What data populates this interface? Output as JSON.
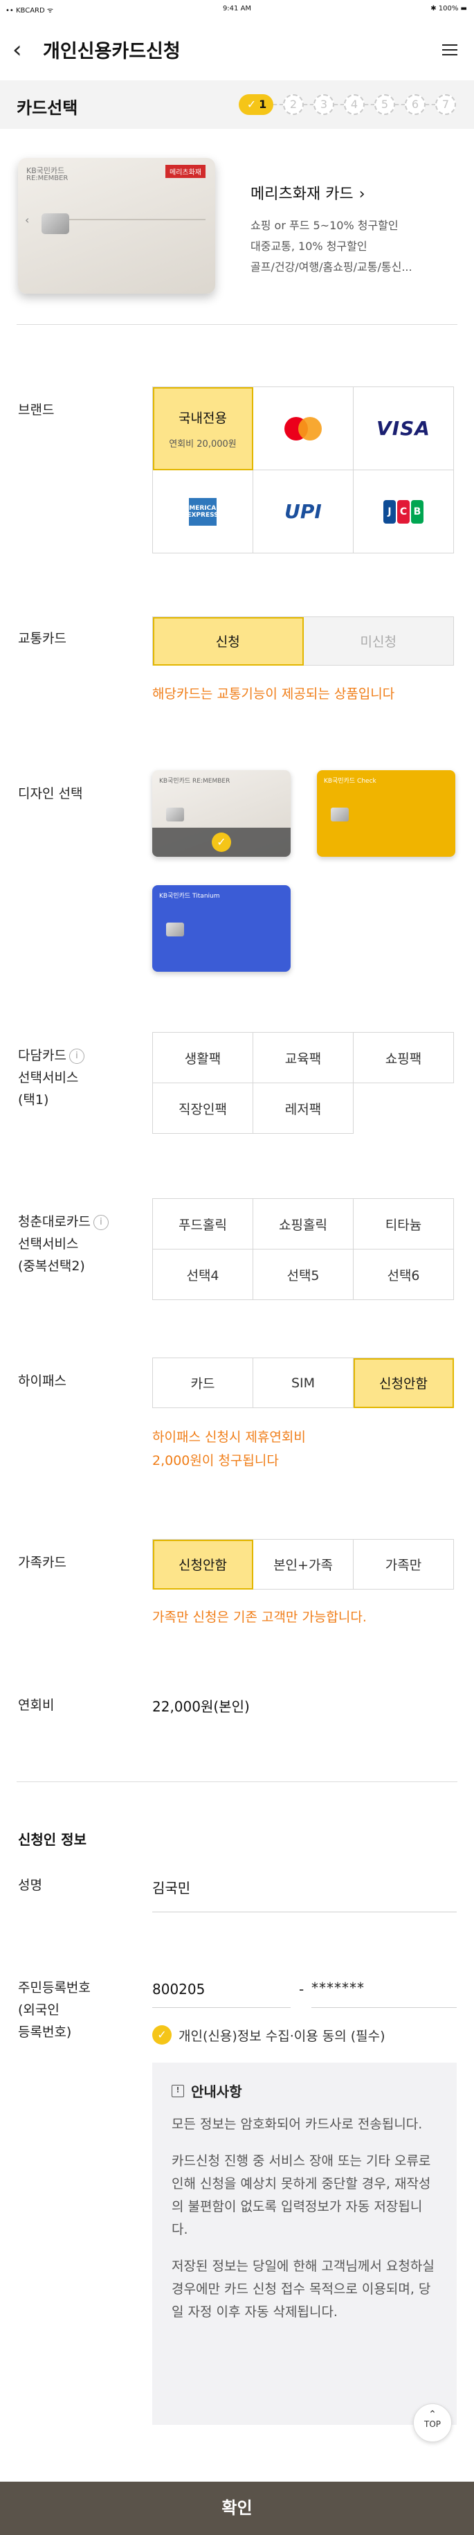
{
  "statusbar": {
    "carrier": "•• KBCARD ᯤ",
    "time": "9:41 AM",
    "battery": "✱ 100% ▬"
  },
  "header": {
    "title": "개인신용카드신청"
  },
  "step_bar": {
    "title": "카드선택",
    "steps": [
      "1",
      "2",
      "3",
      "4",
      "5",
      "6",
      "7"
    ],
    "current_step": 1
  },
  "card": {
    "image_bank": "KB국민카드",
    "image_sub": "RE:MEMBER",
    "image_partner": "메리츠화재",
    "name": "메리츠화재 카드",
    "benefits": [
      "쇼핑 or 푸드 5~10% 청구할인",
      "대중교통, 10% 청구할인",
      "골프/건강/여행/홈쇼핑/교통/통신..."
    ]
  },
  "brand": {
    "label": "브랜드",
    "domestic_label": "국내전용",
    "domestic_fee": "연회비 20,000원",
    "options": [
      "mastercard-logo",
      "visa-logo",
      "amex-logo",
      "upi-logo",
      "jcb-logo"
    ],
    "visa_text": "VISA",
    "upi_text": "UPI",
    "amex_text": "AMERICAN EXPRESS",
    "jcb_letters": [
      "J",
      "C",
      "B"
    ]
  },
  "transit": {
    "label": "교통카드",
    "options": [
      "신청",
      "미신청"
    ],
    "selected": "신청",
    "note": "해당카드는 교통기능이 제공되는 상품입니다"
  },
  "design": {
    "label": "디자인 선택",
    "card_texts": [
      "KB국민카드 RE:MEMBER",
      "KB국민카드 Check",
      "KB국민카드 Titanium"
    ],
    "selected_index": 0
  },
  "multi_service": {
    "label_lines": [
      "다담카드",
      "선택서비스",
      "(택1)"
    ],
    "options": [
      "생활팩",
      "교육팩",
      "쇼핑팩",
      "직장인팩",
      "레저팩"
    ]
  },
  "youth_service": {
    "label_lines": [
      "청춘대로카드",
      "선택서비스",
      "(중복선택2)"
    ],
    "options": [
      "푸드홀릭",
      "쇼핑홀릭",
      "티타늄",
      "선택4",
      "선택5",
      "선택6"
    ]
  },
  "hipass": {
    "label": "하이패스",
    "options": [
      "카드",
      "SIM",
      "신청안함"
    ],
    "selected": "신청안함",
    "note_lines": [
      "하이패스 신청시 제휴연회비",
      "2,000원이 청구됩니다"
    ]
  },
  "family": {
    "label": "가족카드",
    "options": [
      "신청안함",
      "본인+가족",
      "가족만"
    ],
    "selected": "신청안함",
    "note": "가족만 신청은 기존 고객만 가능합니다."
  },
  "annual_fee": {
    "label": "연회비",
    "value": "22,000원(본인)"
  },
  "applicant": {
    "section_title": "신청인 정보",
    "name_label": "성명",
    "name_value": "김국민",
    "rrn_label_lines": [
      "주민등록번호",
      "(외국인",
      "등록번호)"
    ],
    "rrn_front": "800205",
    "rrn_separator": "-",
    "rrn_back": "*******",
    "consent": "개인(신용)정보 수집·이용 동의 (필수)"
  },
  "notice": {
    "title": "안내사항",
    "paragraphs": [
      "모든 정보는 암호화되어 카드사로 전송됩니다.",
      "카드신청 진행 중 서비스 장애 또는 기타 오류로 인해 신청을 예상치 못하게 중단할 경우, 재작성의 불편함이 없도록 입력정보가 자동 저장됩니다.",
      "저장된 정보는 당일에 한해 고객님께서 요청하실 경우에만 카드 신청 접수 목적으로 이용되며, 당일 자정 이후 자동 삭제됩니다."
    ]
  },
  "top_button": "TOP",
  "confirm_button": "확인"
}
